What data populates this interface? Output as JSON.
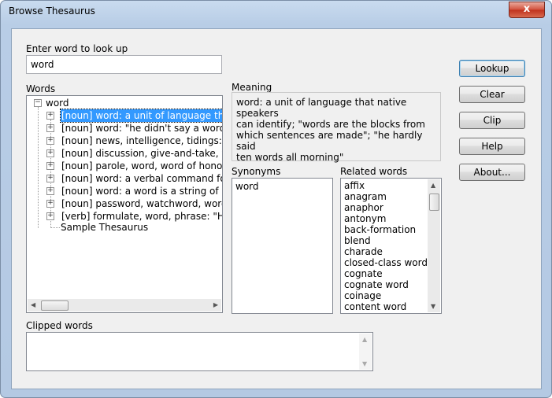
{
  "window": {
    "title": "Browse Thesaurus",
    "close_glyph": "x"
  },
  "lookup": {
    "label": "Enter word to look up",
    "value": "word"
  },
  "words": {
    "label": "Words",
    "root": "word",
    "items": [
      "[noun] word: a unit of language that",
      "[noun] word: \"he didn't say a word a",
      "[noun] news, intelligence, tidings: ne",
      "[noun] discussion, give-and-take, wo",
      "[noun] parole, word, word of honor:",
      "[noun] word: a verbal command for a",
      "[noun] word: a word is a string of bit",
      "[noun] password, watchword, word:",
      "[verb] formulate, word, phrase: \"He"
    ],
    "footer_node": "Sample Thesaurus"
  },
  "meaning": {
    "label": "Meaning",
    "text": "word: a unit of language that native speakers\ncan identify; \"words are the blocks from\nwhich sentences are made\"; \"he hardly said\nten words all morning\""
  },
  "synonyms": {
    "label": "Synonyms",
    "items": [
      "word"
    ]
  },
  "related": {
    "label": "Related words",
    "items": [
      "affix",
      "anagram",
      "anaphor",
      "antonym",
      "back-formation",
      "blend",
      "charade",
      "closed-class word",
      "cognate",
      "cognate word",
      "coinage",
      "content word"
    ]
  },
  "clipped": {
    "label": "Clipped words",
    "value": ""
  },
  "buttons": {
    "lookup": "Lookup",
    "clear": "Clear",
    "clip": "Clip",
    "help": "Help",
    "about": "About..."
  }
}
